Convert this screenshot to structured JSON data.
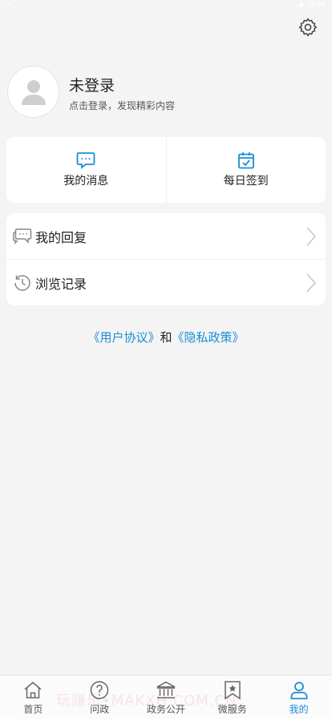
{
  "status_bar": {
    "time": "13:08"
  },
  "profile": {
    "name": "未登录",
    "subtitle": "点击登录，发现精彩内容"
  },
  "quick_actions": [
    {
      "label": "我的消息",
      "icon": "message-icon"
    },
    {
      "label": "每日签到",
      "icon": "calendar-check-icon"
    }
  ],
  "menu": [
    {
      "label": "我的回复",
      "icon": "reply-chat-icon"
    },
    {
      "label": "浏览记录",
      "icon": "history-icon"
    }
  ],
  "legal": {
    "agreement": "《用户协议》",
    "and": "和",
    "privacy": "《隐私政策》"
  },
  "tabbar": {
    "tabs": [
      {
        "label": "首页",
        "icon": "home-icon"
      },
      {
        "label": "问政",
        "icon": "question-icon"
      },
      {
        "label": "政务公开",
        "icon": "bank-icon"
      },
      {
        "label": "微服务",
        "icon": "bookmark-star-icon"
      },
      {
        "label": "我的",
        "icon": "user-icon"
      }
    ],
    "active_index": 4
  },
  "colors": {
    "accent": "#1a8ed6",
    "background": "#f4f4f4"
  },
  "watermark": "玩赚乐•MAKXH.COM.CN"
}
